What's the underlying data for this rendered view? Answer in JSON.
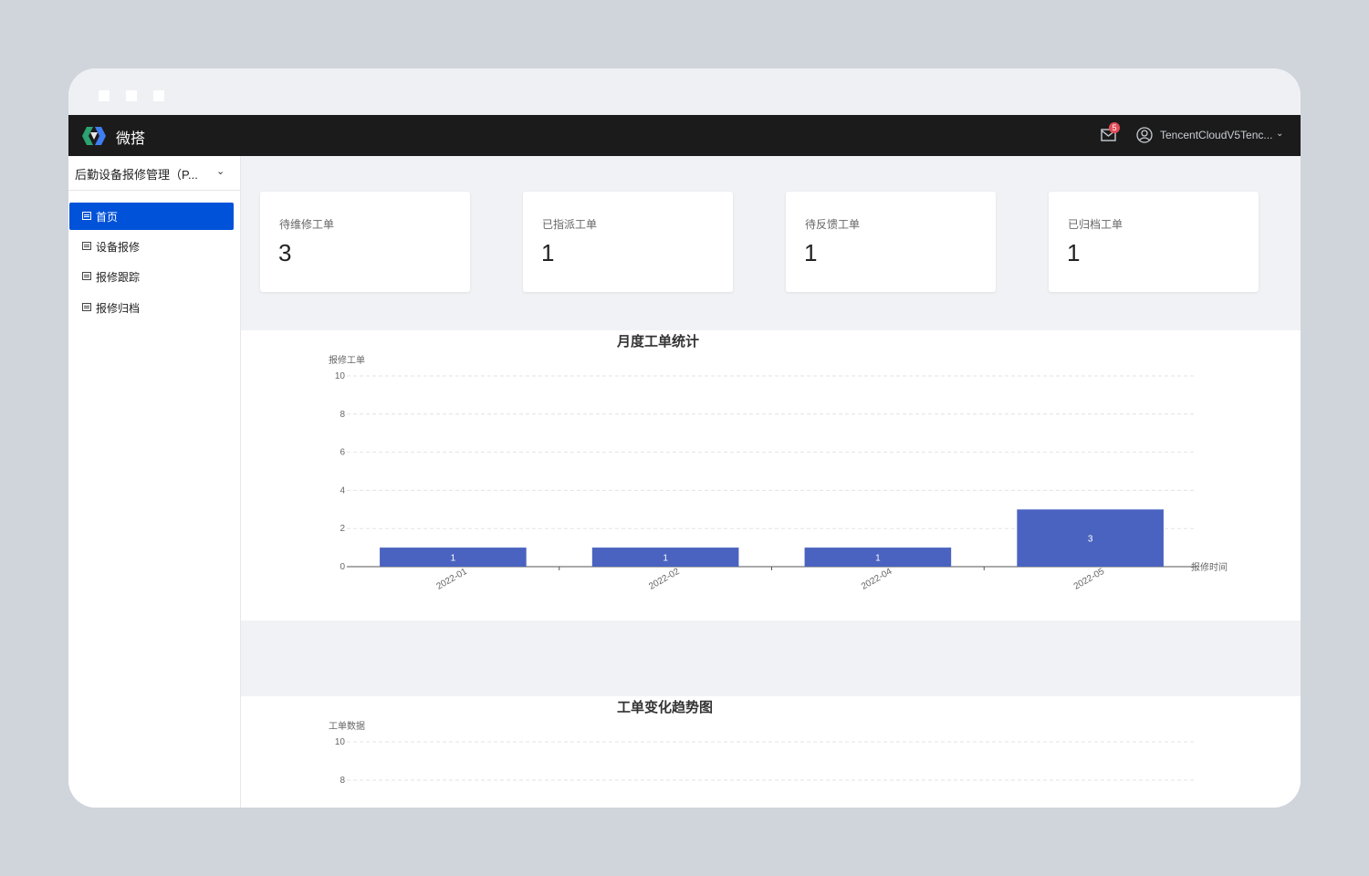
{
  "app": {
    "name": "微搭"
  },
  "header": {
    "mail_badge": "5",
    "user_name": "TencentCloudV5Tenc...",
    "user_chevron": "⌄"
  },
  "sidebar": {
    "app_title": "后勤设备报修管理（P...",
    "chevron": "⌄",
    "items": [
      {
        "label": "首页",
        "active": true
      },
      {
        "label": "设备报修",
        "active": false
      },
      {
        "label": "报修跟踪",
        "active": false
      },
      {
        "label": "报修归档",
        "active": false
      }
    ]
  },
  "stats": [
    {
      "label": "待维修工单",
      "value": "3"
    },
    {
      "label": "已指派工单",
      "value": "1"
    },
    {
      "label": "待反馈工单",
      "value": "1"
    },
    {
      "label": "已归档工单",
      "value": "1"
    }
  ],
  "colors": {
    "accent": "#0052d9",
    "bar": "#4a63c0",
    "topbar": "#1b1b1b",
    "badge": "#e34d59"
  },
  "chart_data": [
    {
      "type": "bar",
      "title": "月度工单统计",
      "ylabel": "报修工单",
      "xlabel": "报修时间",
      "categories": [
        "2022-01",
        "2022-02",
        "2022-04",
        "2022-05"
      ],
      "values": [
        1,
        1,
        1,
        3
      ],
      "ylim": [
        0,
        10
      ],
      "yticks": [
        0,
        2,
        4,
        6,
        8,
        10
      ],
      "grid": true
    },
    {
      "type": "line",
      "title": "工单变化趋势图",
      "ylabel": "工单数据",
      "ylim": [
        0,
        10
      ],
      "yticks_visible": [
        10,
        8
      ],
      "grid": true
    }
  ]
}
